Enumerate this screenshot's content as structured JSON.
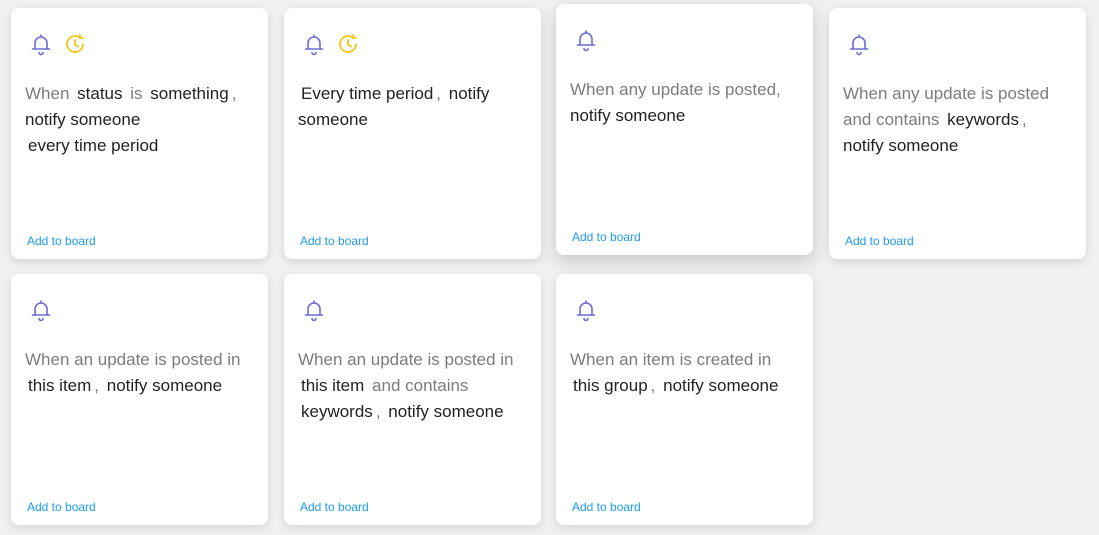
{
  "colors": {
    "bell": "#6c6cd1",
    "clock": "#f5c518",
    "link": "#1f9bf0",
    "keyword": "#222222",
    "text": "#7c7c7c"
  },
  "cards": [
    {
      "icons": [
        "bell-icon",
        "clock-icon"
      ],
      "line1_t1": "When",
      "line1_k1": "status",
      "line1_t2": "is",
      "line1_k2": "something",
      "line1_sep": ",",
      "line2_k1": "notify someone",
      "line3_k1": "every time period",
      "add_label": "Add to board"
    },
    {
      "icons": [
        "bell-icon",
        "clock-icon"
      ],
      "line1_k1": "Every time period",
      "line1_sep": ",",
      "line1_k2": "notify",
      "line2_k1": "someone",
      "add_label": "Add to board"
    },
    {
      "icons": [
        "bell-icon"
      ],
      "line1_t1": "When any update is posted,",
      "line2_k1": "notify someone",
      "add_label": "Add to board"
    },
    {
      "icons": [
        "bell-icon"
      ],
      "line1_t1": "When any update is posted",
      "line2_t1": "and contains",
      "line2_k1": "keywords",
      "line2_sep": ",",
      "line3_k1": "notify someone",
      "add_label": "Add to board"
    },
    {
      "icons": [
        "bell-icon"
      ],
      "line1_t1": "When an update is posted in",
      "line2_k1": "this item",
      "line2_sep": ",",
      "line2_k2": "notify someone",
      "add_label": "Add to board"
    },
    {
      "icons": [
        "bell-icon"
      ],
      "line1_t1": "When an update is posted in",
      "line2_k1": "this item",
      "line2_t1": "and contains",
      "line3_k1": "keywords",
      "line3_sep": ",",
      "line3_k2": "notify someone",
      "add_label": "Add to board"
    },
    {
      "icons": [
        "bell-icon"
      ],
      "line1_t1": "When an item is created in",
      "line2_k1": "this group",
      "line2_sep": ",",
      "line2_k2": "notify someone",
      "add_label": "Add to board"
    }
  ]
}
